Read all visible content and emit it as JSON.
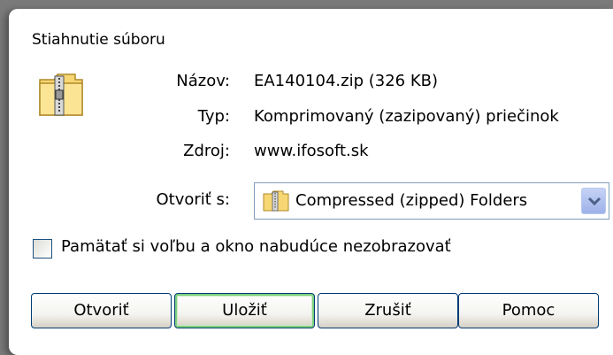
{
  "dialog": {
    "title": "Stiahnutie súboru",
    "fields": {
      "name_label": "Názov:",
      "name_value": "EA140104.zip (326 KB)",
      "type_label": "Typ:",
      "type_value": "Komprimovaný (zazipovaný) priečinok",
      "source_label": "Zdroj:",
      "source_value": "www.ifosoft.sk",
      "open_with_label": "Otvoriť s:"
    },
    "open_with_select": {
      "icon": "zip-folder-icon",
      "selected": "Compressed (zipped) Folders"
    },
    "remember_checkbox": {
      "label": "Pamätať si voľbu a okno nabudúce nezobrazovať",
      "checked": false
    },
    "buttons": {
      "open": "Otvoriť",
      "save": "Uložiť",
      "cancel": "Zrušiť",
      "help": "Pomoc"
    }
  },
  "colors": {
    "dialog_bg": "#ffffff",
    "backdrop": "#7a7a7a",
    "button_border": "#003c74",
    "default_button_focus": "#7ed07e",
    "dropdown_arrow": "#9db1e8"
  }
}
